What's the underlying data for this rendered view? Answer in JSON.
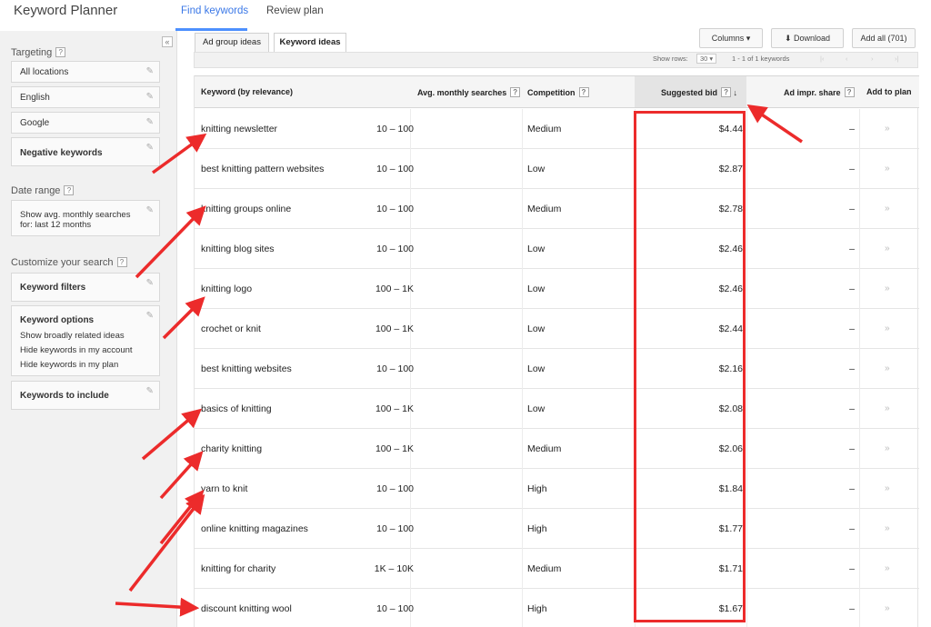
{
  "header": {
    "app_title": "Keyword Planner",
    "tabs": [
      "Find keywords",
      "Review plan"
    ]
  },
  "sidebar": {
    "collapse_glyph": "«",
    "targeting_label": "Targeting",
    "targeting_items": [
      "All locations",
      "English",
      "Google",
      "Negative keywords"
    ],
    "date_range_label": "Date range",
    "date_range_value_1": "Show avg. monthly searches",
    "date_range_value_2": "for: last 12 months",
    "customize_label": "Customize your search",
    "keyword_filters": "Keyword filters",
    "keyword_options_title": "Keyword options",
    "keyword_options": [
      "Show broadly related ideas",
      "Hide keywords in my account",
      "Hide keywords in my plan"
    ],
    "keywords_to_include": "Keywords to include"
  },
  "toolbar": {
    "subtabs": [
      "Ad group ideas",
      "Keyword ideas"
    ],
    "columns_label": "Columns",
    "download_label": "Download",
    "add_all_label": "Add all (701)",
    "show_rows_label": "Show rows:",
    "show_rows_value": "30",
    "range_label": "1 - 1 of 1 keywords"
  },
  "table": {
    "headers": {
      "keyword": "Keyword (by relevance)",
      "searches": "Avg. monthly searches",
      "competition": "Competition",
      "bid": "Suggested bid",
      "impr": "Ad impr. share",
      "add": "Add to plan"
    },
    "rows": [
      {
        "keyword": "knitting newsletter",
        "searches": "10 – 100",
        "competition": "Medium",
        "bid": "$4.44",
        "impr": "–",
        "add": "»"
      },
      {
        "keyword": "best knitting pattern websites",
        "searches": "10 – 100",
        "competition": "Low",
        "bid": "$2.87",
        "impr": "–",
        "add": "»"
      },
      {
        "keyword": "knitting groups online",
        "searches": "10 – 100",
        "competition": "Medium",
        "bid": "$2.78",
        "impr": "–",
        "add": "»"
      },
      {
        "keyword": "knitting blog sites",
        "searches": "10 – 100",
        "competition": "Low",
        "bid": "$2.46",
        "impr": "–",
        "add": "»"
      },
      {
        "keyword": "knitting logo",
        "searches": "100 – 1K",
        "competition": "Low",
        "bid": "$2.46",
        "impr": "–",
        "add": "»"
      },
      {
        "keyword": "crochet or knit",
        "searches": "100 – 1K",
        "competition": "Low",
        "bid": "$2.44",
        "impr": "–",
        "add": "»"
      },
      {
        "keyword": "best knitting websites",
        "searches": "10 – 100",
        "competition": "Low",
        "bid": "$2.16",
        "impr": "–",
        "add": "»"
      },
      {
        "keyword": "basics of knitting",
        "searches": "100 – 1K",
        "competition": "Low",
        "bid": "$2.08",
        "impr": "–",
        "add": "»"
      },
      {
        "keyword": "charity knitting",
        "searches": "100 – 1K",
        "competition": "Medium",
        "bid": "$2.06",
        "impr": "–",
        "add": "»"
      },
      {
        "keyword": "yarn to knit",
        "searches": "10 – 100",
        "competition": "High",
        "bid": "$1.84",
        "impr": "–",
        "add": "»"
      },
      {
        "keyword": "online knitting magazines",
        "searches": "10 – 100",
        "competition": "High",
        "bid": "$1.77",
        "impr": "–",
        "add": "»"
      },
      {
        "keyword": "knitting for charity",
        "searches": "1K – 10K",
        "competition": "Medium",
        "bid": "$1.71",
        "impr": "–",
        "add": "»"
      },
      {
        "keyword": "discount knitting wool",
        "searches": "10 – 100",
        "competition": "High",
        "bid": "$1.67",
        "impr": "–",
        "add": "»"
      }
    ]
  },
  "colors": {
    "accent": "#4d90fe",
    "annotation_red": "#ec2b2b"
  }
}
